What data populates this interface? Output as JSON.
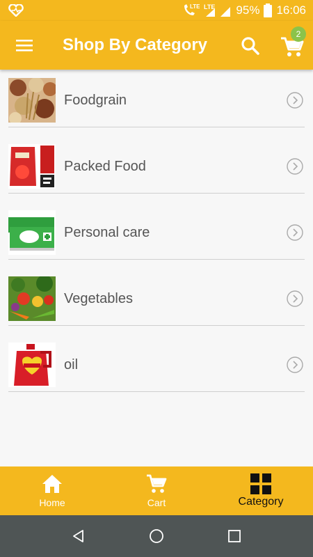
{
  "status_bar": {
    "network_1": "LTE",
    "network_2": "LTE",
    "battery": "95%",
    "time": "16:06"
  },
  "app_bar": {
    "title": "Shop By Category",
    "cart_count": "2"
  },
  "categories": [
    {
      "label": "Foodgrain",
      "image": "grains-photo"
    },
    {
      "label": "Packed Food",
      "image": "ketchup-pouch-photo"
    },
    {
      "label": "Personal care",
      "image": "dettol-soap-photo"
    },
    {
      "label": "Vegetables",
      "image": "vegetables-photo"
    },
    {
      "label": "oil",
      "image": "oil-can-photo"
    }
  ],
  "bottom_nav": {
    "items": [
      {
        "label": "Home",
        "icon": "home-icon"
      },
      {
        "label": "Cart",
        "icon": "cart-icon"
      },
      {
        "label": "Category",
        "icon": "grid-icon"
      }
    ],
    "active": "Category"
  },
  "colors": {
    "primary": "#f4b81e",
    "badge": "#8bc34a",
    "system_nav": "#4f5555"
  }
}
